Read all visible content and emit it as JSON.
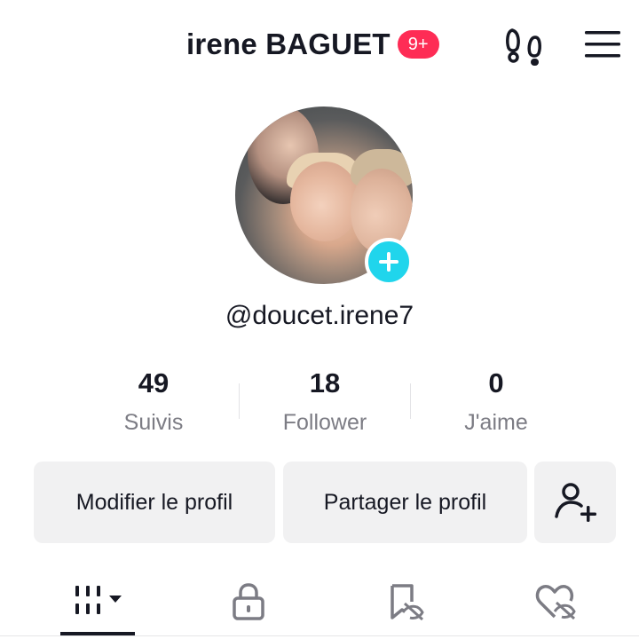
{
  "header": {
    "title": "irene BAGUET",
    "badge": "9+",
    "footprints_icon": "footprints-icon",
    "menu_icon": "hamburger-menu-icon"
  },
  "profile": {
    "avatar_icon": "profile-photo",
    "add_icon": "plus-icon",
    "handle": "@doucet.irene7"
  },
  "stats": [
    {
      "value": "49",
      "label": "Suivis"
    },
    {
      "value": "18",
      "label": "Follower"
    },
    {
      "value": "0",
      "label": "J'aime"
    }
  ],
  "actions": {
    "edit_profile": "Modifier le profil",
    "share_profile": "Partager le profil",
    "add_friend_icon": "add-user-icon"
  },
  "tabs": [
    {
      "icon": "videos-grid-icon",
      "active": true
    },
    {
      "icon": "lock-icon",
      "active": false
    },
    {
      "icon": "bookmark-hidden-icon",
      "active": false
    },
    {
      "icon": "heart-hidden-icon",
      "active": false
    }
  ],
  "colors": {
    "badge": "#fe2c55",
    "plus": "#20d5ec",
    "text": "#161823",
    "muted": "#7c7c84",
    "button_bg": "#f1f1f2"
  }
}
